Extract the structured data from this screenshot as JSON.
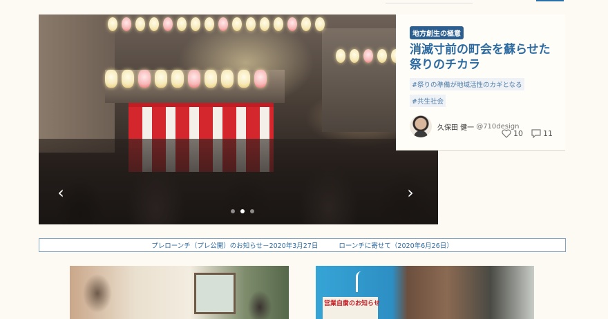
{
  "hero": {
    "prev_arrow": "‹",
    "next_arrow": "›",
    "slide_count": 3,
    "active_slide": 2
  },
  "article": {
    "category": "地方創生の極意",
    "title_line1": "消滅寸前の町会を蘇らせた",
    "title_line2": "祭りのチカラ",
    "tags": [
      "#祭りの準備が地域活性のカギとなる",
      "#共生社会"
    ],
    "author_name": "久保田 健一",
    "author_handle": "@710design",
    "likes": "10",
    "comments": "11"
  },
  "notice": {
    "prelaunch": "プレローンチ（プレ公開）のお知らせ－2020年3月27日",
    "launch": "ローンチに寄せて（2020年6月26日）"
  },
  "thumbnails": [
    {
      "label": ""
    },
    {
      "poster_text": "営業自粛のお知らせ"
    }
  ],
  "colors": {
    "accent": "#2d6ba1",
    "badge": "#2c5f8f",
    "background": "#fdfaf3"
  }
}
